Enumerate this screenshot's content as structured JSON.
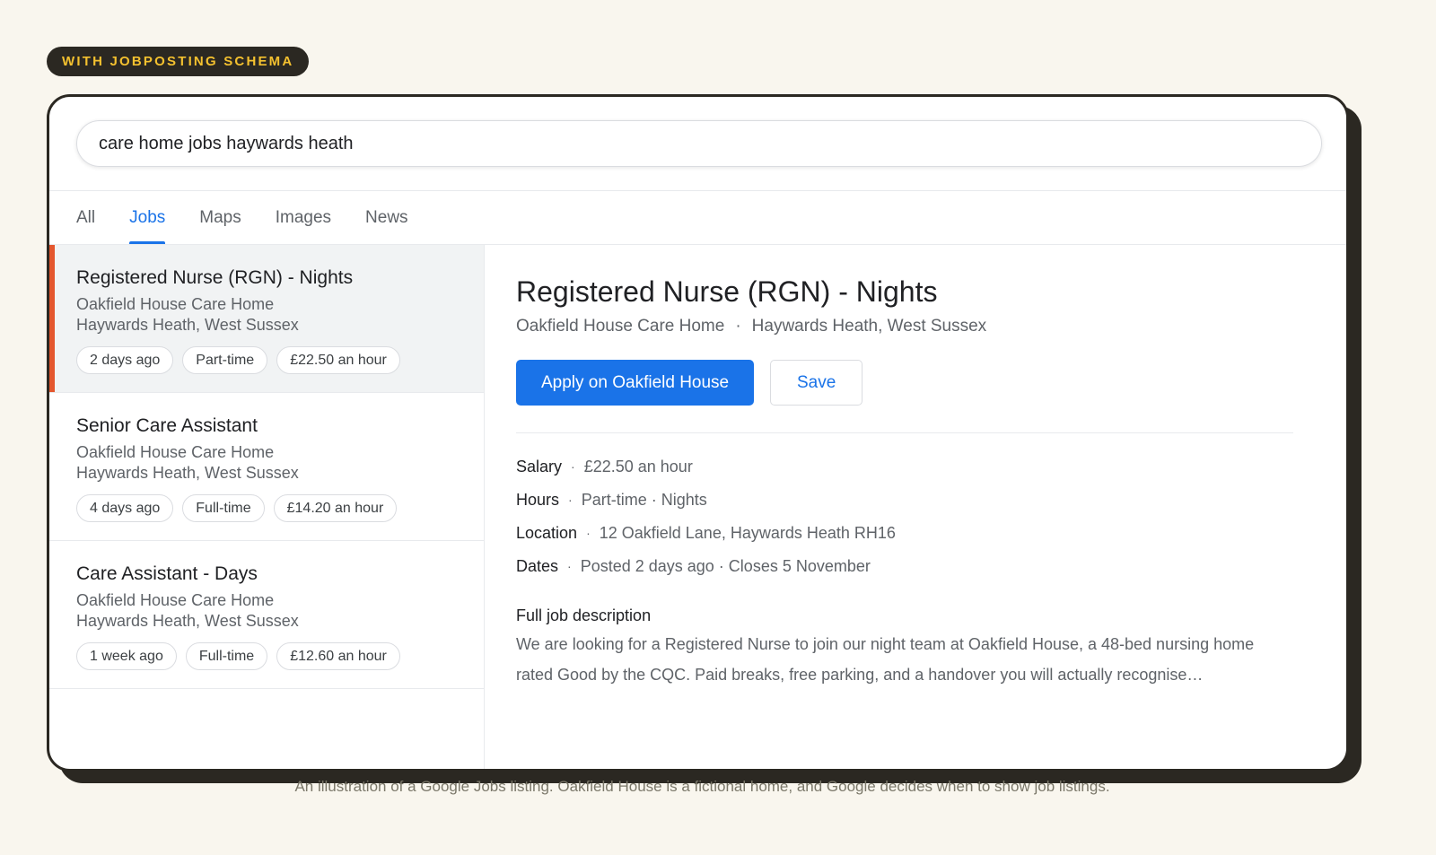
{
  "badge": "WITH JOBPOSTING SCHEMA",
  "search": {
    "query": "care home jobs haywards heath"
  },
  "tabs": [
    {
      "label": "All"
    },
    {
      "label": "Jobs"
    },
    {
      "label": "Maps"
    },
    {
      "label": "Images"
    },
    {
      "label": "News"
    }
  ],
  "jobs": [
    {
      "title": "Registered Nurse (RGN) - Nights",
      "company": "Oakfield House Care Home",
      "location": "Haywards Heath, West Sussex",
      "posted": "2 days ago",
      "type": "Part-time",
      "pay": "£22.50 an hour"
    },
    {
      "title": "Senior Care Assistant",
      "company": "Oakfield House Care Home",
      "location": "Haywards Heath, West Sussex",
      "posted": "4 days ago",
      "type": "Full-time",
      "pay": "£14.20 an hour"
    },
    {
      "title": "Care Assistant - Days",
      "company": "Oakfield House Care Home",
      "location": "Haywards Heath, West Sussex",
      "posted": "1 week ago",
      "type": "Full-time",
      "pay": "£12.60 an hour"
    }
  ],
  "detail": {
    "title": "Registered Nurse (RGN) - Nights",
    "company": "Oakfield House Care Home",
    "location": "Haywards Heath, West Sussex",
    "apply_label": "Apply on Oakfield House",
    "save_label": "Save",
    "facts": [
      {
        "label": "Salary",
        "value": "£22.50 an hour"
      },
      {
        "label": "Hours",
        "value": "Part-time · Nights"
      },
      {
        "label": "Location",
        "value": "12 Oakfield Lane, Haywards Heath RH16"
      },
      {
        "label": "Dates",
        "value": "Posted 2 days ago · Closes 5 November"
      }
    ],
    "description_heading": "Full job description",
    "description": "We are looking for a Registered Nurse to join our night team at Oakfield House, a 48-bed nursing home rated Good by the CQC. Paid breaks, free parking, and a handover you will actually recognise…"
  },
  "caption": "An illustration of a Google Jobs listing. Oakfield House is a fictional home, and Google decides when to show job listings.",
  "colors": {
    "accent": "#1a73e8",
    "selected_marker": "#e4572e",
    "badge_text": "#f4c12f",
    "frame": "#2b2822",
    "background": "#f9f6ee"
  }
}
